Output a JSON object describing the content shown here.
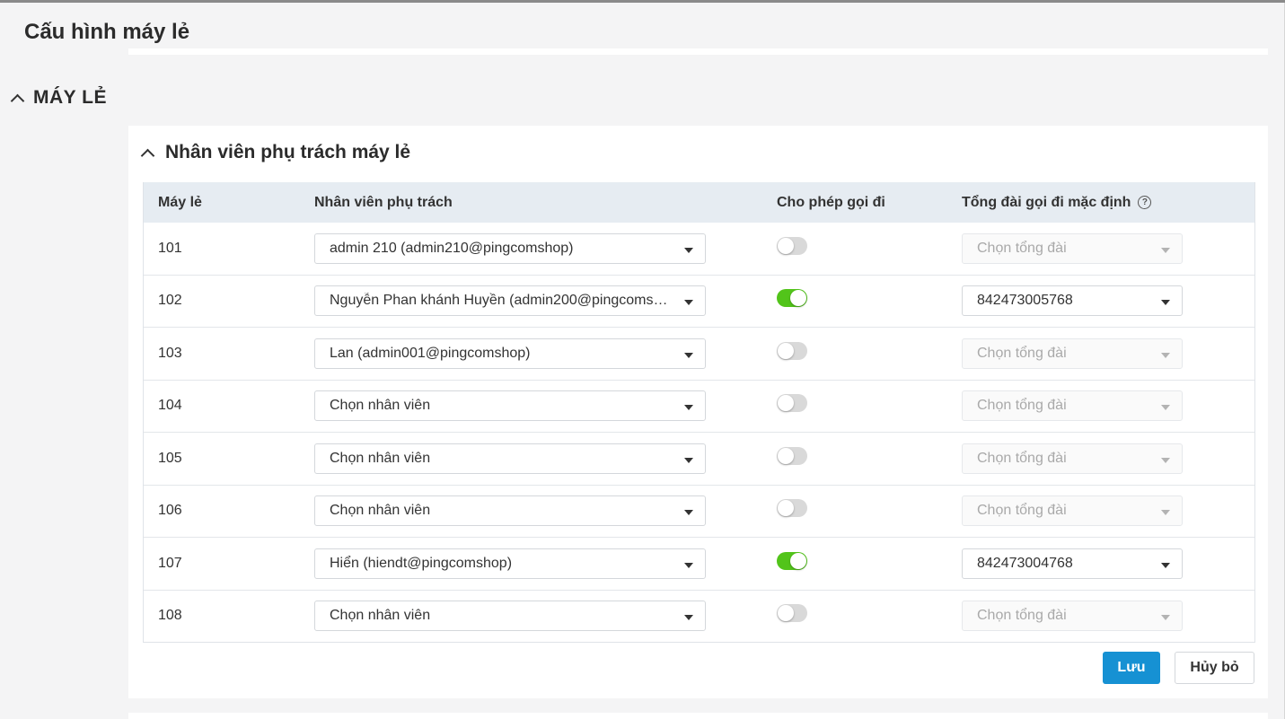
{
  "page_title": "Cấu hình máy lẻ",
  "section": {
    "title": "MÁY LẺ"
  },
  "card": {
    "title": "Nhân viên phụ trách máy lẻ",
    "columns": [
      "Máy lẻ",
      "Nhân viên phụ trách",
      "Cho phép gọi đi",
      "Tổng đài gọi đi mặc định"
    ],
    "help_glyph": "?",
    "rows": [
      {
        "ext": "101",
        "staff": "admin 210 (admin210@pingcomshop)",
        "allow": false,
        "trunk": "Chọn tổng đài"
      },
      {
        "ext": "102",
        "staff": "Nguyễn Phan khánh Huyền (admin200@pingcomshop)",
        "allow": true,
        "trunk": "842473005768"
      },
      {
        "ext": "103",
        "staff": "Lan (admin001@pingcomshop)",
        "allow": false,
        "trunk": "Chọn tổng đài"
      },
      {
        "ext": "104",
        "staff": "Chọn nhân viên",
        "allow": false,
        "trunk": "Chọn tổng đài"
      },
      {
        "ext": "105",
        "staff": "Chọn nhân viên",
        "allow": false,
        "trunk": "Chọn tổng đài"
      },
      {
        "ext": "106",
        "staff": "Chọn nhân viên",
        "allow": false,
        "trunk": "Chọn tổng đài"
      },
      {
        "ext": "107",
        "staff": "Hiển (hiendt@pingcomshop)",
        "allow": true,
        "trunk": "842473004768"
      },
      {
        "ext": "108",
        "staff": "Chọn nhân viên",
        "allow": false,
        "trunk": "Chọn tổng đài"
      }
    ],
    "save_label": "Lưu",
    "cancel_label": "Hủy bỏ"
  },
  "colors": {
    "accent": "#1691d3",
    "toggle_on": "#52c41a",
    "header_bg": "#e6ecf2"
  },
  "icons": [
    "chevron-up-icon",
    "help-icon",
    "caret-down-icon"
  ]
}
